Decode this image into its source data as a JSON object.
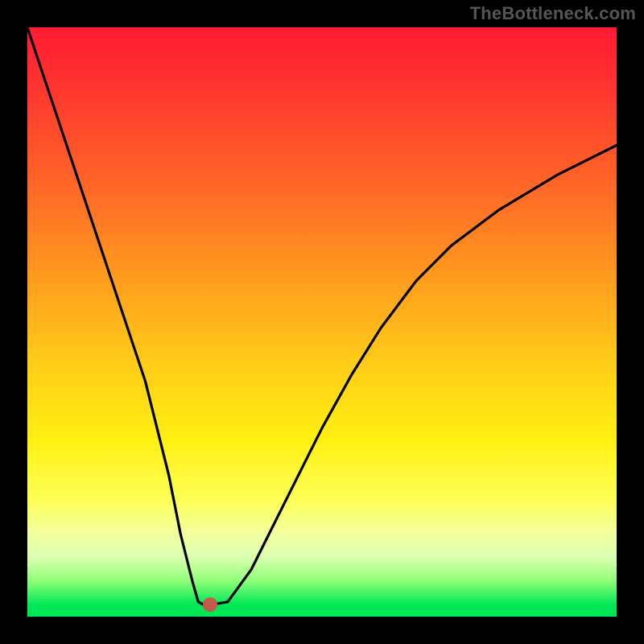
{
  "watermark": "TheBottleneck.com",
  "chart_data": {
    "type": "line",
    "title": "",
    "xlabel": "",
    "ylabel": "",
    "xlim": [
      0,
      100
    ],
    "ylim": [
      0,
      100
    ],
    "grid": false,
    "legend": false,
    "series": [
      {
        "name": "bottleneck-curve",
        "x": [
          0,
          2,
          5,
          8,
          12,
          16,
          20,
          24,
          26,
          28,
          29,
          30,
          31,
          34,
          38,
          42,
          46,
          50,
          55,
          60,
          66,
          72,
          80,
          90,
          100
        ],
        "y": [
          100,
          94,
          85,
          76,
          64,
          52,
          40,
          24,
          14,
          6,
          2.5,
          2,
          2,
          2.5,
          8,
          16,
          24,
          32,
          41,
          49,
          57,
          63,
          69,
          75,
          80
        ]
      }
    ],
    "optimal_point": {
      "x": 31,
      "y": 2
    },
    "colors": {
      "curve": "#000000",
      "point": "#c65a4a",
      "background_top": "#ff1a33",
      "background_bottom": "#00e756",
      "frame": "#000000"
    }
  }
}
